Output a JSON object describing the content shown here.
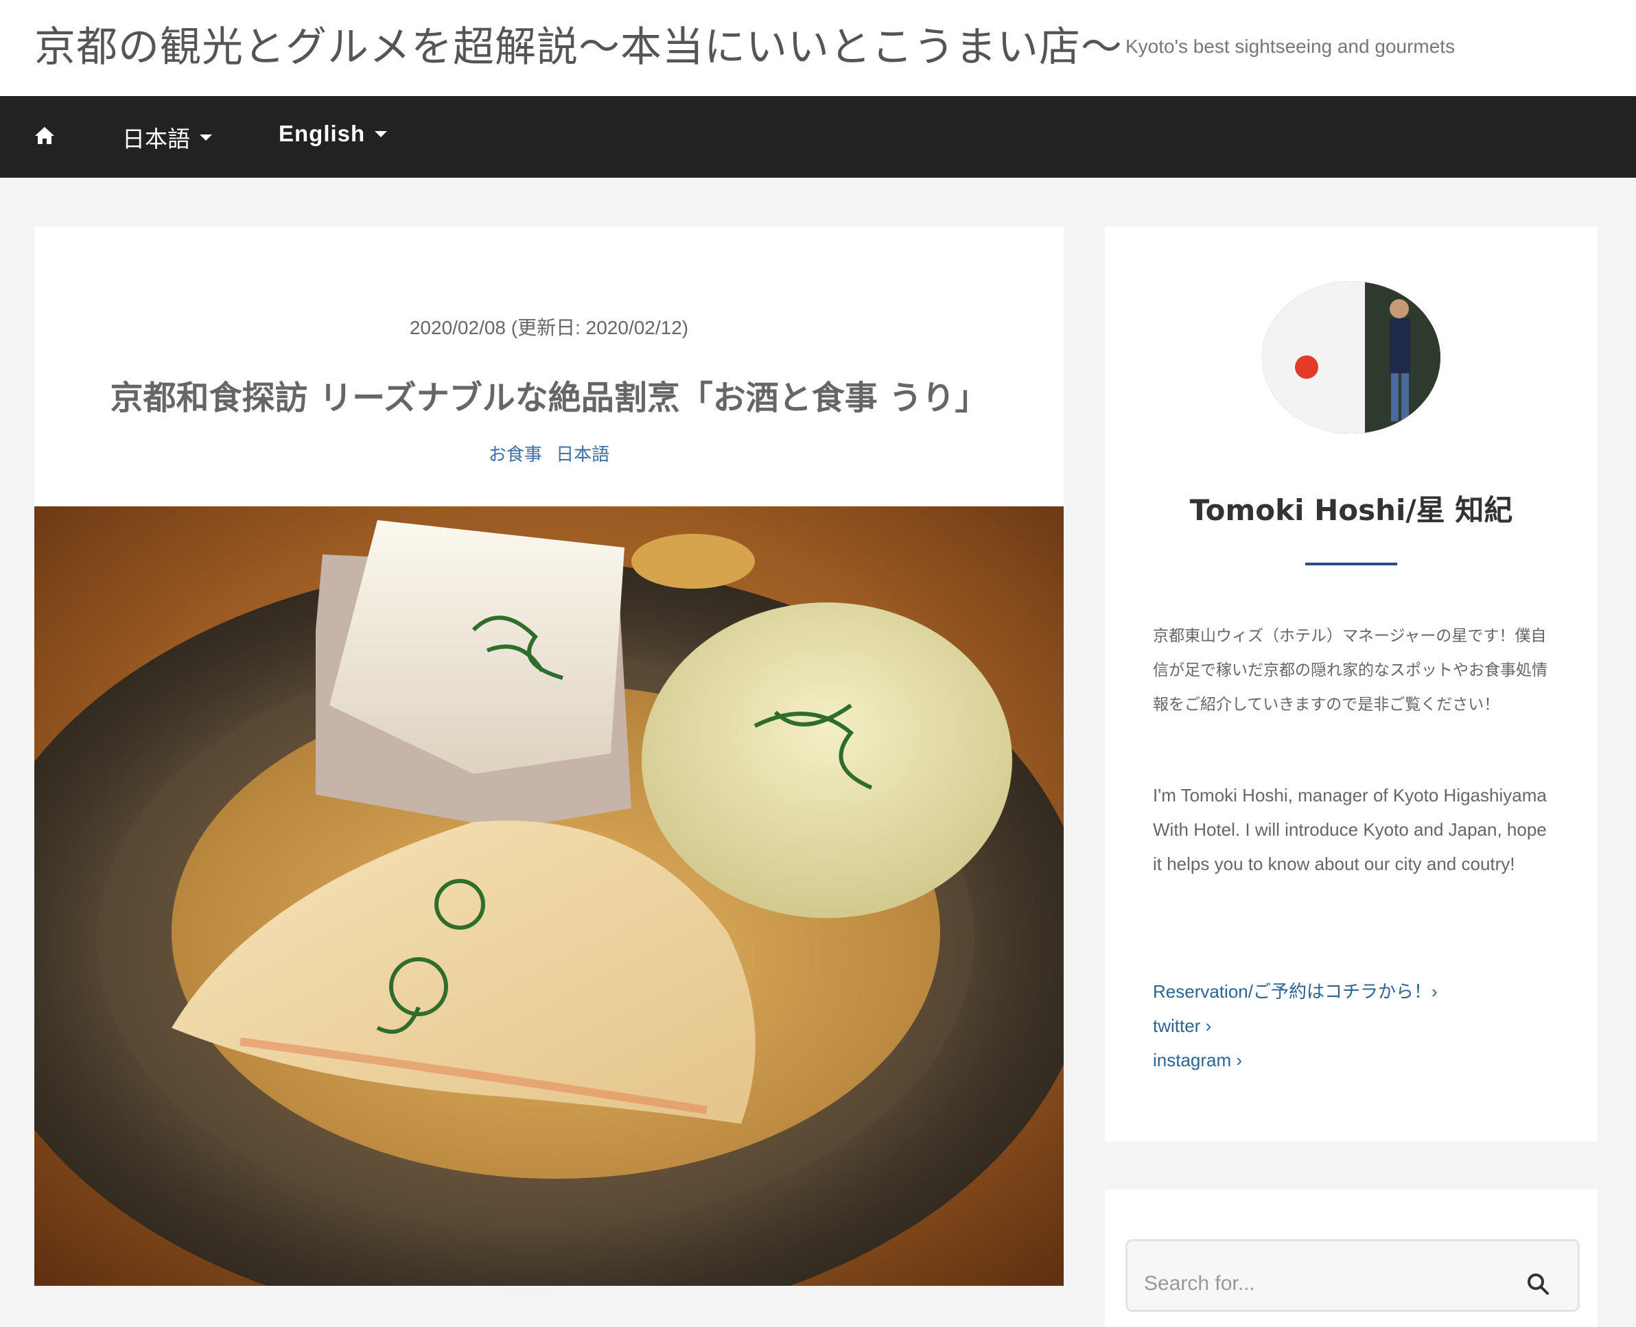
{
  "header": {
    "site_title": "京都の観光とグルメを超解説〜本当にいいとこうまい店〜",
    "tagline": "Kyoto's best sightseeing and gourmets"
  },
  "nav": {
    "home_icon": "home-icon",
    "items": [
      {
        "label": "日本語",
        "icon": "caret-down-icon"
      },
      {
        "label": "English",
        "icon": "caret-down-icon"
      }
    ]
  },
  "post": {
    "date": "2020/02/08 (更新日: 2020/02/12)",
    "title": "京都和食探訪 リーズナブルな絶品割烹「お酒と食事 うり」",
    "categories": [
      "お食事",
      "日本語"
    ],
    "hero_image": "oden-dish-photo"
  },
  "sidebar": {
    "avatar": "author-avatar-photo",
    "author_name": "Tomoki Hoshi/星 知紀",
    "bio_ja": "京都東山ウィズ（ホテル）マネージャーの星です！僕自信が足で稼いだ京都の隠れ家的なスポットやお食事処情報をご紹介していきますので是非ご覧ください！",
    "bio_en": "I'm Tomoki Hoshi, manager of Kyoto Higashiyama With Hotel. I will introduce Kyoto and Japan, hope it helps you to know about our city and coutry!",
    "links": [
      "Reservation/ご予約はコチラから！›",
      "twitter ›",
      "instagram ›"
    ]
  },
  "search": {
    "placeholder": "Search for..."
  },
  "colors": {
    "navbar": "#222222",
    "link": "#2a6496",
    "accent_rule": "#2c4a8c",
    "background": "#f4f4f4"
  }
}
